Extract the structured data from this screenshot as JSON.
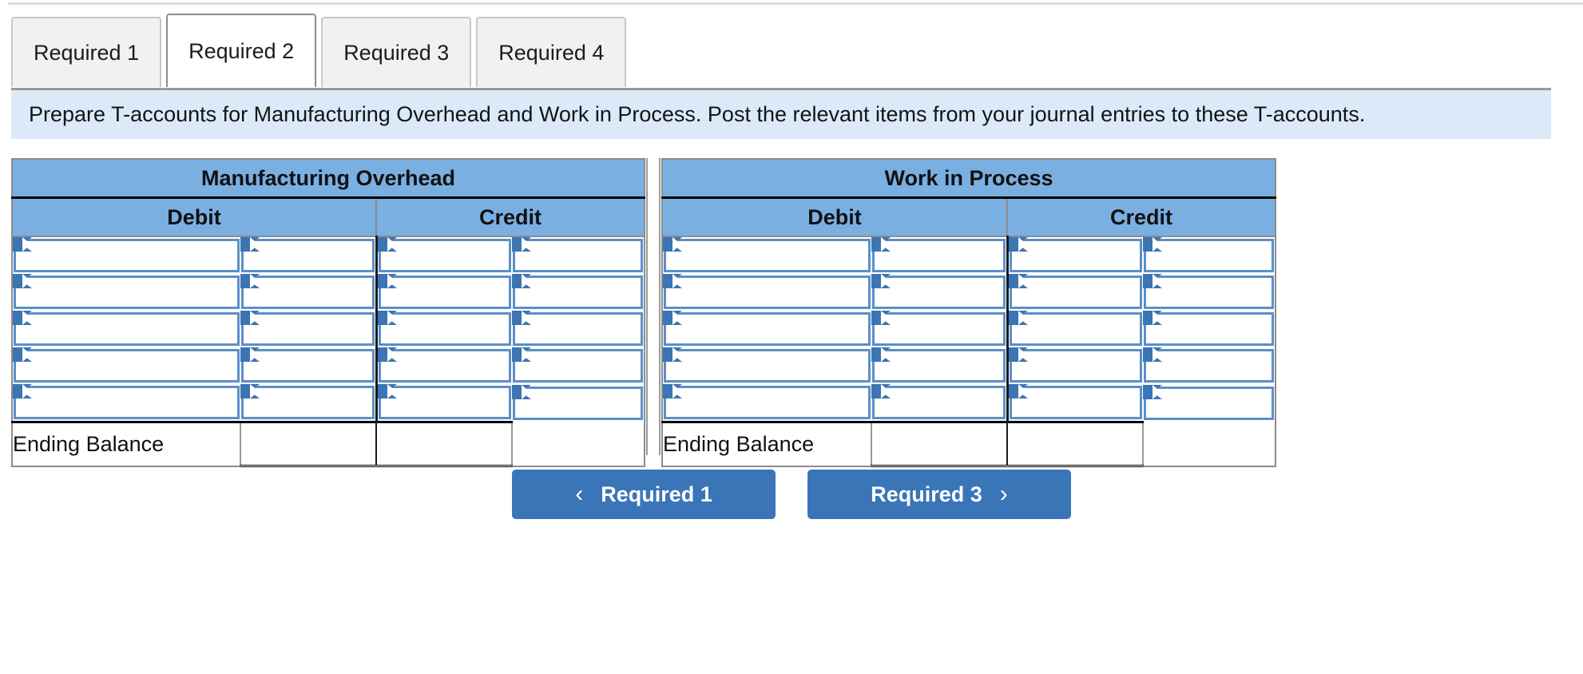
{
  "tabs": [
    {
      "label": "Required 1",
      "active": false
    },
    {
      "label": "Required 2",
      "active": true
    },
    {
      "label": "Required 3",
      "active": false
    },
    {
      "label": "Required 4",
      "active": false
    }
  ],
  "instruction": "Prepare T-accounts for Manufacturing Overhead and Work in Process. Post the relevant items from your journal entries to these T-accounts.",
  "accounts": [
    {
      "title": "Manufacturing Overhead",
      "debit_header": "Debit",
      "credit_header": "Credit",
      "entry_row_count": 5,
      "ending_balance_label": "Ending Balance",
      "entries": [
        {
          "debit_desc": "",
          "debit_amount": "",
          "credit_amount": "",
          "credit_desc": ""
        },
        {
          "debit_desc": "",
          "debit_amount": "",
          "credit_amount": "",
          "credit_desc": ""
        },
        {
          "debit_desc": "",
          "debit_amount": "",
          "credit_amount": "",
          "credit_desc": ""
        },
        {
          "debit_desc": "",
          "debit_amount": "",
          "credit_amount": "",
          "credit_desc": ""
        },
        {
          "debit_desc": "",
          "debit_amount": "",
          "credit_amount": "",
          "credit_desc": ""
        }
      ],
      "ending_balance_debit": "",
      "ending_balance_credit": ""
    },
    {
      "title": "Work in Process",
      "debit_header": "Debit",
      "credit_header": "Credit",
      "entry_row_count": 5,
      "ending_balance_label": "Ending Balance",
      "entries": [
        {
          "debit_desc": "",
          "debit_amount": "",
          "credit_amount": "",
          "credit_desc": ""
        },
        {
          "debit_desc": "",
          "debit_amount": "",
          "credit_amount": "",
          "credit_desc": ""
        },
        {
          "debit_desc": "",
          "debit_amount": "",
          "credit_amount": "",
          "credit_desc": ""
        },
        {
          "debit_desc": "",
          "debit_amount": "",
          "credit_amount": "",
          "credit_desc": ""
        },
        {
          "debit_desc": "",
          "debit_amount": "",
          "credit_amount": "",
          "credit_desc": ""
        }
      ],
      "ending_balance_debit": "",
      "ending_balance_credit": ""
    }
  ],
  "nav": {
    "prev_label": "Required 1",
    "prev_chevron": "‹",
    "next_label": "Required 3",
    "next_chevron": "›"
  },
  "colors": {
    "header_blue": "#7aafe2",
    "button_blue": "#3a75b8",
    "banner_blue": "#dbe9f8",
    "input_border": "#5b8fc9",
    "marker_blue": "#3c74b4"
  }
}
